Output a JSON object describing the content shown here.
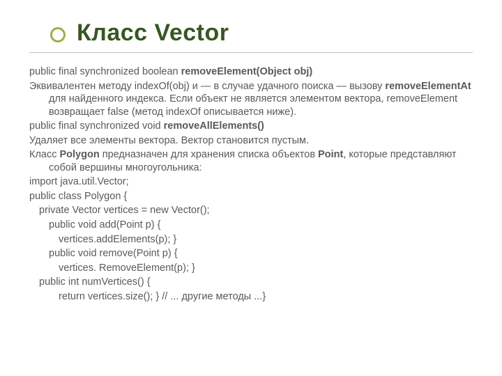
{
  "title": "Класс Vector",
  "body": {
    "sig1": {
      "prefix": "public final synchronized boolean ",
      "bold": "removeElement(Object obj)"
    },
    "desc1": {
      "a": "Эквивалентен методу indexOf(obj) и — в случае удачного поиска — вызову ",
      "b": "removeElementAt",
      "c": " для найденного индекса. Если объект не является элементом вектора, removeElement возвращает false (метод indexOf описывается ниже)."
    },
    "sig2": {
      "prefix": "public final synchronized void ",
      "bold": "removeAllElements()"
    },
    "desc2": "Удаляет все элементы вектора. Вектор становится пустым.",
    "poly": {
      "a": "Класс ",
      "b": "Polygon",
      "c": " предназначен для хранения списка объектов ",
      "d": "Point",
      "e": ", которые представляют собой вершины многоугольника:"
    },
    "code": [
      "import java.util.Vector;",
      "public class Polygon {",
      "private Vector vertices = new Vector();",
      "public void add(Point p) {",
      "vertices.addElements(p);      }",
      "public void remove(Point p) {",
      "vertices. RemoveElement(p);      }",
      "public int numVertices() {",
      "return vertices.size();      }      // ... другие методы ...}"
    ]
  }
}
